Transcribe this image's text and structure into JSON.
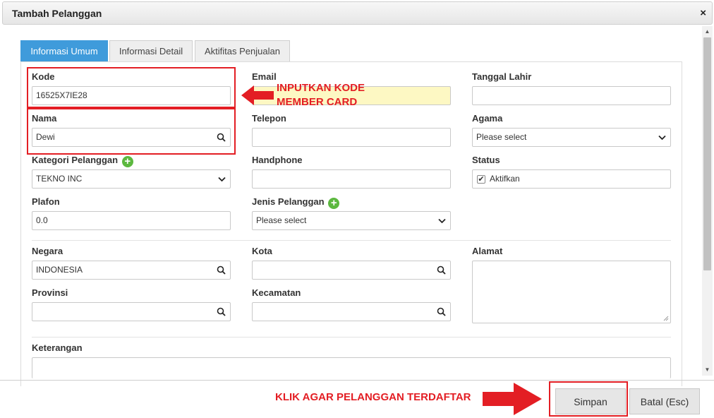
{
  "dialog": {
    "title": "Tambah Pelanggan",
    "close_symbol": "×"
  },
  "tabs": [
    {
      "label": "Informasi Umum",
      "active": true
    },
    {
      "label": "Informasi Detail",
      "active": false
    },
    {
      "label": "Aktifitas Penjualan",
      "active": false
    }
  ],
  "form": {
    "kode": {
      "label": "Kode",
      "value": "16525X7IE28"
    },
    "nama": {
      "label": "Nama",
      "value": "Dewi"
    },
    "kategori": {
      "label": "Kategori Pelanggan",
      "value": "TEKNO INC"
    },
    "plafon": {
      "label": "Plafon",
      "value": "0.0"
    },
    "email": {
      "label": "Email",
      "value": ""
    },
    "telepon": {
      "label": "Telepon",
      "value": ""
    },
    "handphone": {
      "label": "Handphone",
      "value": ""
    },
    "jenis": {
      "label": "Jenis Pelanggan",
      "value": "Please select"
    },
    "tanggal_lahir": {
      "label": "Tanggal Lahir",
      "value": ""
    },
    "agama": {
      "label": "Agama",
      "value": "Please select"
    },
    "status": {
      "label": "Status",
      "checkbox_label": "Aktifkan",
      "checked": true
    },
    "negara": {
      "label": "Negara",
      "value": "INDONESIA"
    },
    "provinsi": {
      "label": "Provinsi",
      "value": ""
    },
    "kota": {
      "label": "Kota",
      "value": ""
    },
    "kecamatan": {
      "label": "Kecamatan",
      "value": ""
    },
    "alamat": {
      "label": "Alamat",
      "value": ""
    },
    "keterangan": {
      "label": "Keterangan",
      "value": ""
    }
  },
  "annotations": {
    "kode_line1": "INPUTKAN KODE",
    "kode_line2": "MEMBER CARD",
    "simpan_hint": "KLIK AGAR PELANGGAN TERDAFTAR",
    "color": "#e31e24"
  },
  "buttons": {
    "simpan": "Simpan",
    "batal": "Batal (Esc)"
  },
  "colors": {
    "active_tab": "#3f9bdb",
    "add_icon": "#5cb83f",
    "email_highlight": "#fdf8c3"
  }
}
